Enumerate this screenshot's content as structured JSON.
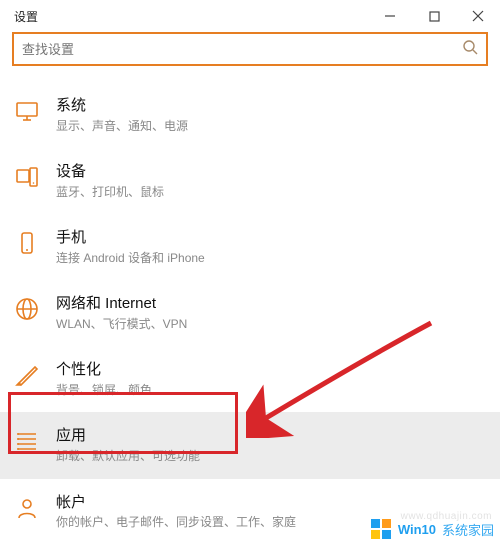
{
  "window": {
    "title": "设置"
  },
  "search": {
    "placeholder": "查找设置"
  },
  "items": [
    {
      "key": "system",
      "title": "系统",
      "sub": "显示、声音、通知、电源"
    },
    {
      "key": "devices",
      "title": "设备",
      "sub": "蓝牙、打印机、鼠标"
    },
    {
      "key": "phone",
      "title": "手机",
      "sub": "连接 Android 设备和 iPhone"
    },
    {
      "key": "network",
      "title": "网络和 Internet",
      "sub": "WLAN、飞行模式、VPN"
    },
    {
      "key": "personal",
      "title": "个性化",
      "sub": "背景、锁屏、颜色"
    },
    {
      "key": "apps",
      "title": "应用",
      "sub": "卸载、默认应用、可选功能"
    },
    {
      "key": "accounts",
      "title": "帐户",
      "sub": "你的帐户、电子邮件、同步设置、工作、家庭"
    }
  ],
  "watermark": {
    "brand": "Win10",
    "text": "系统家园",
    "url": "www.qdhuajin.com"
  }
}
